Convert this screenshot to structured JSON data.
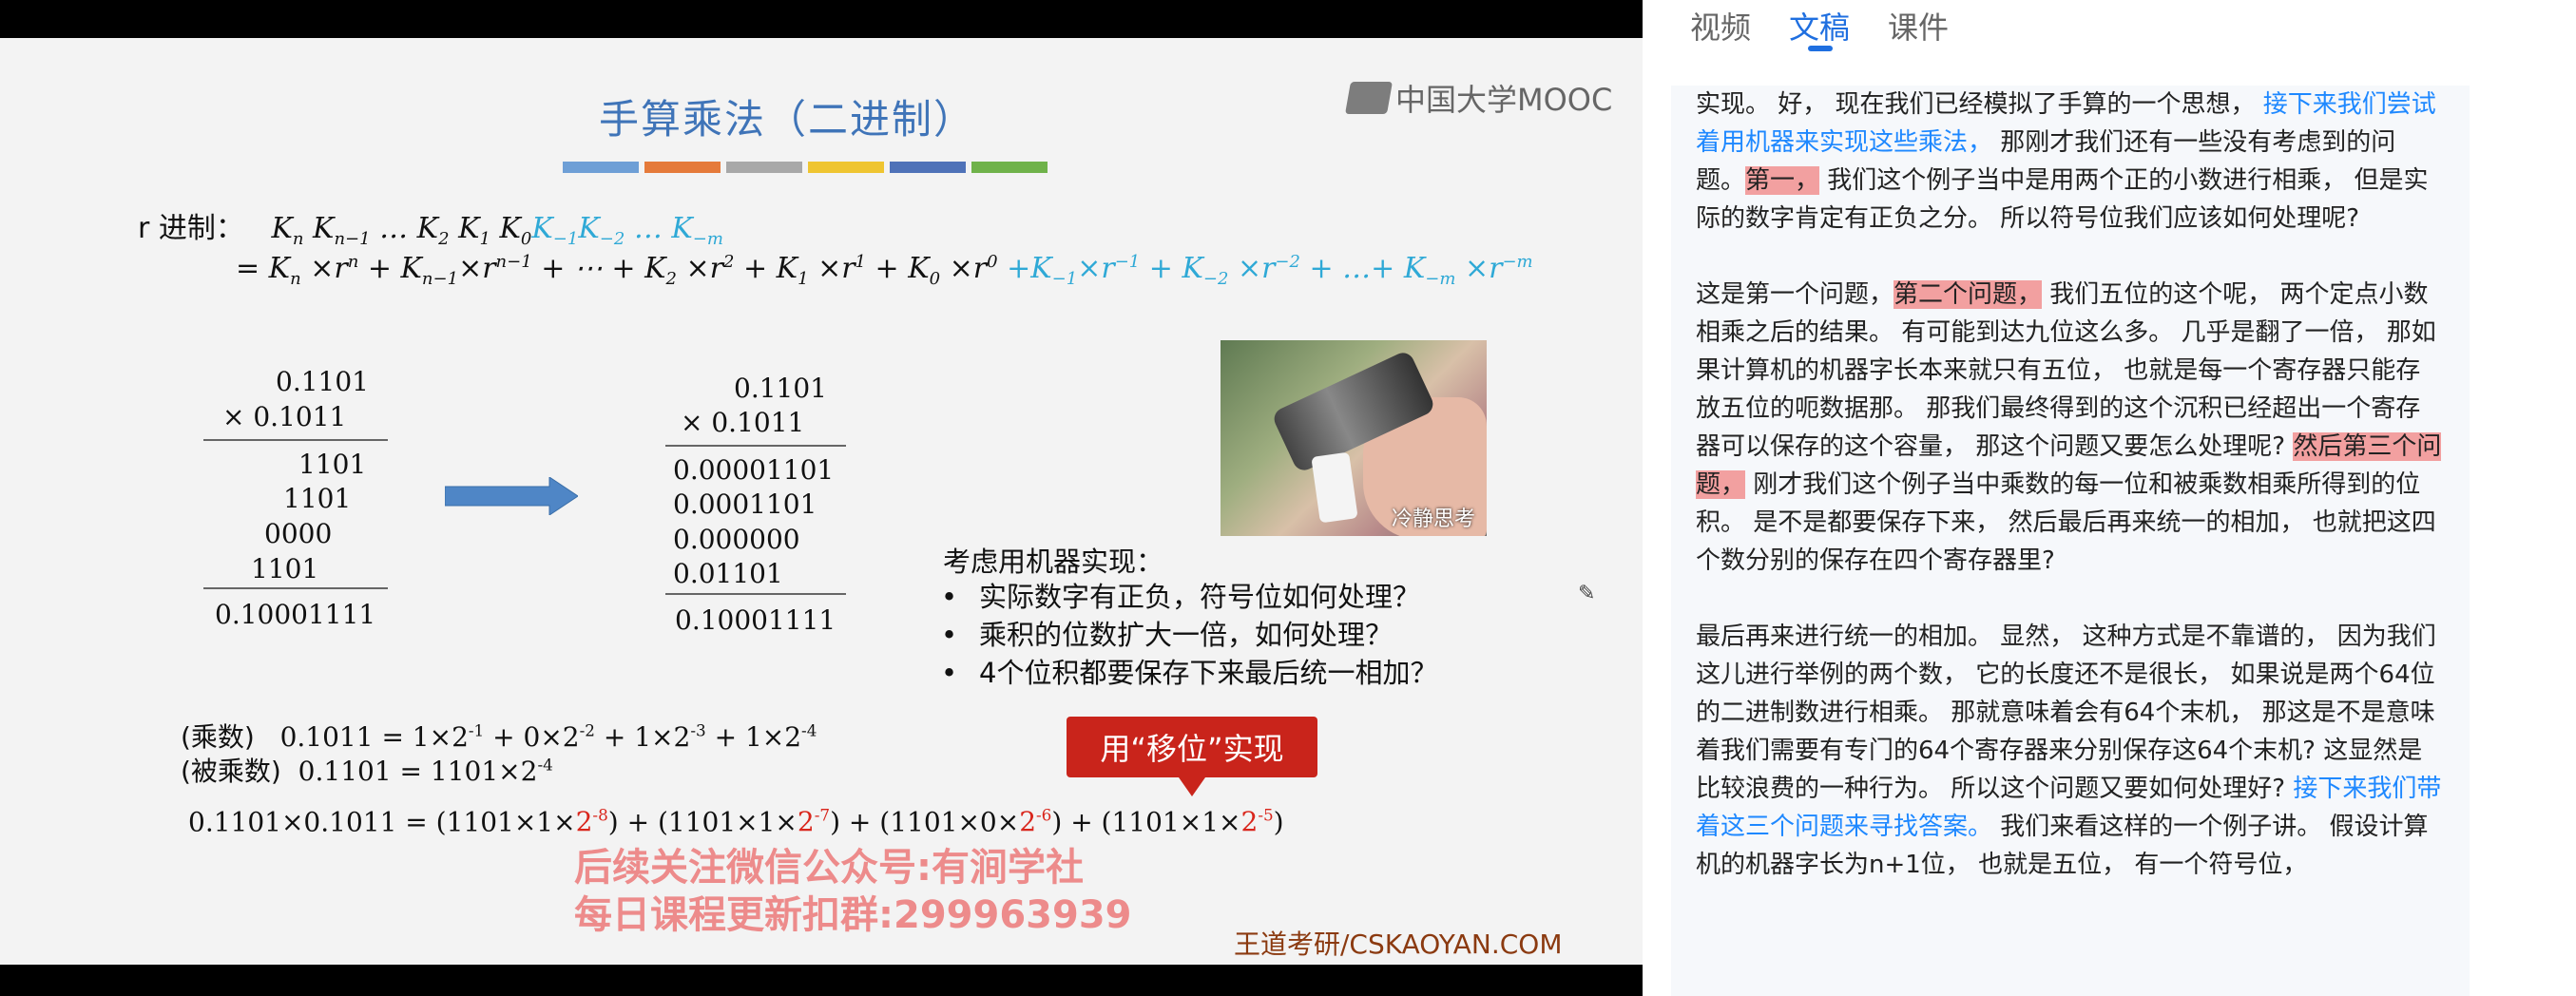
{
  "slide": {
    "title": "手算乘法（二进制）",
    "brand": "中国大学MOOC",
    "swatch_colors": [
      "#6e9fd6",
      "#e57a3a",
      "#a8a8a8",
      "#efc531",
      "#4f72b8",
      "#6fb24a"
    ],
    "r_label": "r 进制：",
    "mul_left": [
      "0.1101",
      "×  0.1011",
      "1101",
      "1101",
      "0000",
      "1101",
      "0.10001111"
    ],
    "mul_right": [
      "0.1101",
      "×  0.1011",
      "0.00001101",
      "0.0001101",
      "0.000000",
      "0.01101",
      "0.10001111"
    ],
    "photo_caption": "冷静思考",
    "consider_title": "考虑用机器实现：",
    "bullets": [
      "实际数字有正负，符号位如何处理？",
      "乘积的位数扩大一倍，如何处理？",
      "4个位积都要保存下来最后统一相加？"
    ],
    "label_multiplier": "(乘数)",
    "label_multiplicand": "(被乘数)",
    "shift_callout": "用“移位”实现",
    "watermark_line1": "后续关注微信公众号:有涧学社",
    "watermark_line2": "每日课程更新扣群:299963939",
    "footer_brand": "王道考研/CSKAOYAN.COM"
  },
  "tabs": [
    {
      "label": "视频",
      "active": false
    },
    {
      "label": "文稿",
      "active": true
    },
    {
      "label": "课件",
      "active": false
    }
  ],
  "transcript": {
    "p1": {
      "a": "实现。 好， 现在我们已经模拟了手算的一个思想， ",
      "b": "接下来我们尝试着用机器来实现这些乘法，",
      "c": " 那刚才我们还有一些没有考虑到的问题。",
      "d": "第一，",
      "e": " 我们这个例子当中是用两个正的小数进行相乘， 但是实际的数字肯定有正负之分。 所以符号位我们应该如何处理呢?"
    },
    "p2": {
      "a": "这是第一个问题，",
      "b": "第二个问题，",
      "c": " 我们五位的这个呢， 两个定点小数相乘之后的结果。 有可能到达九位这么多。 几乎是翻了一倍， 那如果计算机的机器字长本来就只有五位， 也就是每一个寄存器只能存放五位的呃数据那。 那我们最终得到的这个沉积已经超出一个寄存器可以保存的这个容量， 那这个问题又要怎么处理呢? ",
      "d": "然后第三个问题，",
      "e": " 刚才我们这个例子当中乘数的每一位和被乘数相乘所得到的位积。 是不是都要保存下来， 然后最后再来统一的相加， 也就把这四个数分别的保存在四个寄存器里?"
    },
    "p3": {
      "a": "最后再来进行统一的相加。 显然， 这种方式是不靠谱的， 因为我们这儿进行举例的两个数， 它的长度还不是很长， 如果说是两个64位的二进制数进行相乘。 那就意味着会有64个末机， 那这是不是意味着我们需要有专门的64个寄存器来分别保存这64个末机? 这显然是比较浪费的一种行为。 所以这个问题又要如何处理好? ",
      "b": "接下来我们带着这三个问题来寻找答案。",
      "c": " 我们来看这样的一个例子讲。 假设计算机的机器字长为n+1位， 也就是五位， 有一个符号位，"
    }
  }
}
